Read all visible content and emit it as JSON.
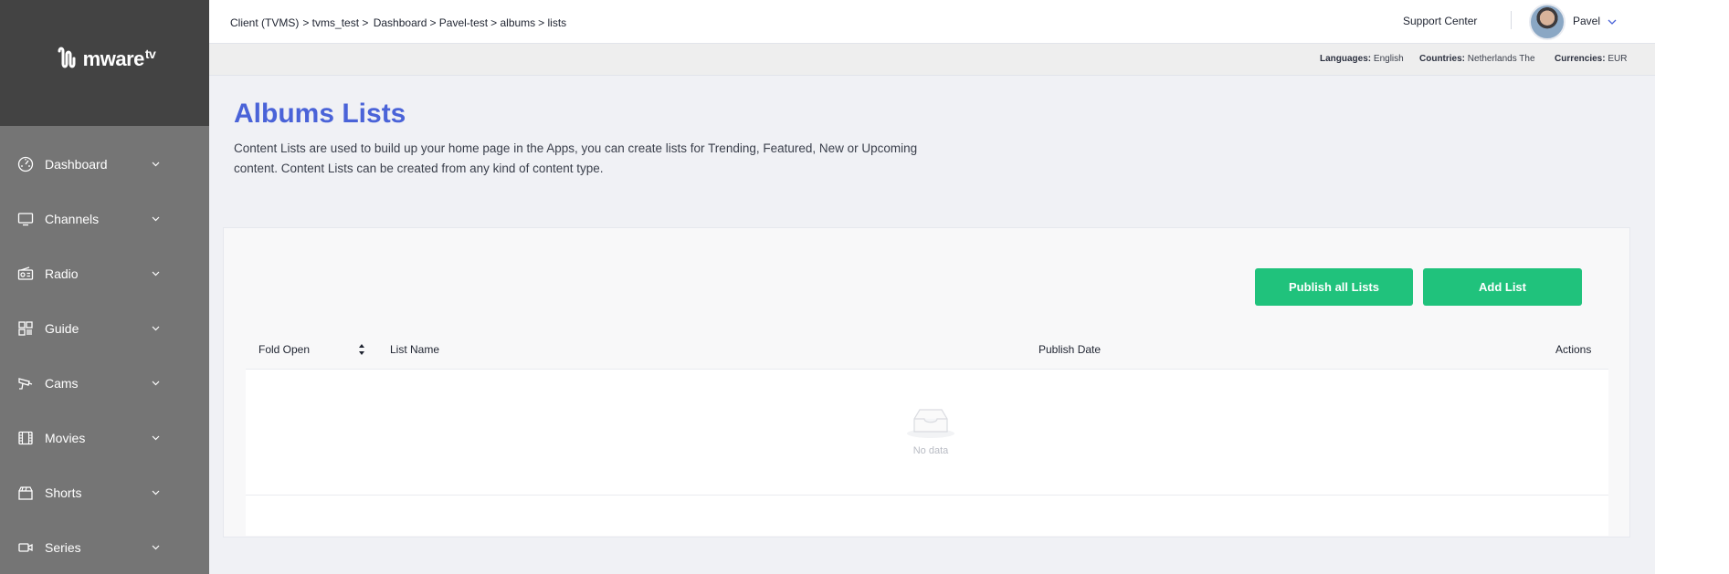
{
  "app": {
    "logo_text": "mware",
    "logo_sup": "tv"
  },
  "sidebar": {
    "items": [
      {
        "label": "Dashboard",
        "icon": "dashboard-gauge-icon"
      },
      {
        "label": "Channels",
        "icon": "monitor-icon"
      },
      {
        "label": "Radio",
        "icon": "radio-icon"
      },
      {
        "label": "Guide",
        "icon": "grid-icon"
      },
      {
        "label": "Cams",
        "icon": "camera-icon"
      },
      {
        "label": "Movies",
        "icon": "film-icon"
      },
      {
        "label": "Shorts",
        "icon": "clapper-icon"
      },
      {
        "label": "Series",
        "icon": "video-camera-icon"
      }
    ]
  },
  "topbar": {
    "breadcrumb": [
      "Client (TVMS)",
      " > tvms_test",
      " > ",
      "Dashboard",
      " > Pavel-test",
      " > albums",
      " > lists"
    ],
    "support": "Support Center",
    "user": "Pavel"
  },
  "subbar": {
    "languages_label": "Languages:",
    "languages_value": "English",
    "countries_label": "Countries:",
    "countries_value": "Netherlands The",
    "currencies_label": "Currencies:",
    "currencies_value": "EUR"
  },
  "page": {
    "title": "Albums Lists",
    "description": "Content Lists are used to build up your home page in the Apps, you can create lists for Trending, Featured, New or Upcoming content. Content Lists can be created from any kind of content type."
  },
  "actions": {
    "publish_all": "Publish all Lists",
    "add_list": "Add List"
  },
  "table": {
    "columns": [
      "Fold Open",
      "List Name",
      "Publish Date",
      "Actions"
    ],
    "empty_text": "No data"
  },
  "colors": {
    "accent": "#4a63d8",
    "primary_button": "#20c27c",
    "sidebar": "#757575",
    "sidebar_header": "#434343"
  }
}
